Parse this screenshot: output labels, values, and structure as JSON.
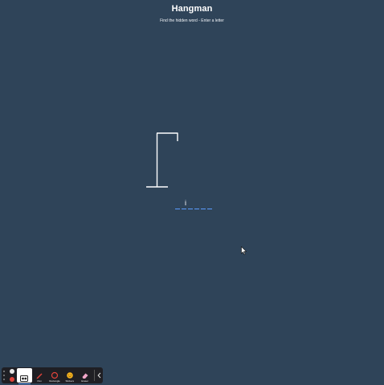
{
  "header": {
    "title": "Hangman",
    "subtitle": "Find the hidden word - Enter a letter"
  },
  "game": {
    "guessed_letter": "i",
    "word_length": 6,
    "blank_color": "#5a9cff",
    "gallows_color": "#ffffff"
  },
  "colors": {
    "background": "#2f4459",
    "toolbar_bg": "#1f1f24"
  },
  "toolbar": {
    "record_icons": [
      "record-icon",
      "stop-icon"
    ],
    "tools": [
      {
        "id": "select",
        "label": "",
        "icon": "select-icon",
        "active": true
      },
      {
        "id": "pen",
        "label": "Pen",
        "icon": "pen-icon",
        "active": false
      },
      {
        "id": "rectangle",
        "label": "Rectangle",
        "icon": "rectangle-icon",
        "active": false
      },
      {
        "id": "stickers",
        "label": "Stickers",
        "icon": "sticker-icon",
        "active": false
      },
      {
        "id": "eraser",
        "label": "Eraser",
        "icon": "eraser-icon",
        "active": false
      }
    ],
    "pen_label": "Pen",
    "rectangle_label": "Rectangle",
    "stickers_label": "Stickers",
    "eraser_label": "Eraser"
  }
}
